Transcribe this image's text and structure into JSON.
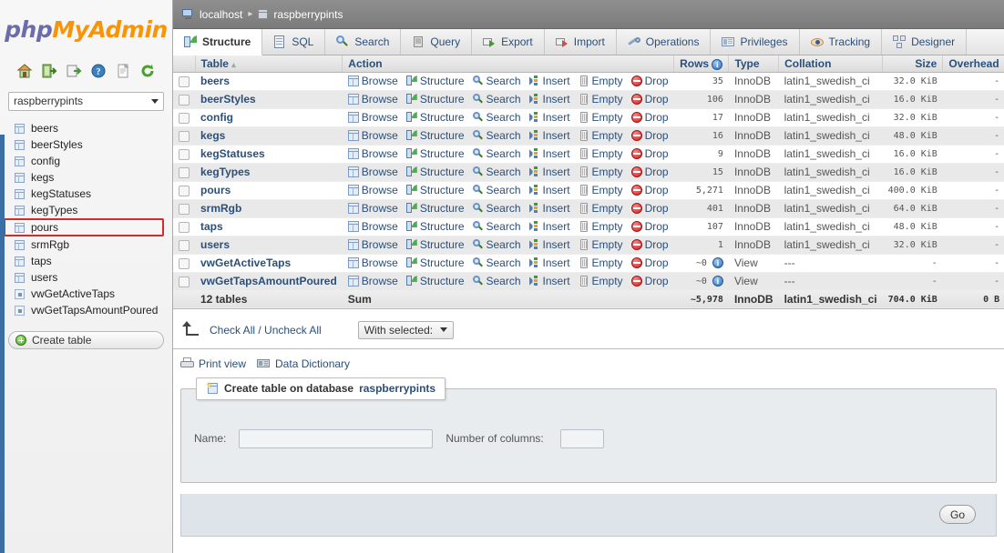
{
  "brand": {
    "php": "php",
    "my": "My",
    "admin": "Admin"
  },
  "sidebar": {
    "icons": [
      {
        "name": "home-icon",
        "title": "Home"
      },
      {
        "name": "logout-icon",
        "title": "Log out"
      },
      {
        "name": "query-window-icon",
        "title": "SQL query window"
      },
      {
        "name": "help-icon",
        "title": "phpMyAdmin documentation"
      },
      {
        "name": "docs-icon",
        "title": "Documentation"
      },
      {
        "name": "reload-icon",
        "title": "Reload navigation"
      }
    ],
    "db_select": {
      "value": "raspberrypints"
    },
    "tables": [
      {
        "label": "beers",
        "kind": "table",
        "highlighted": false
      },
      {
        "label": "beerStyles",
        "kind": "table",
        "highlighted": false
      },
      {
        "label": "config",
        "kind": "table",
        "highlighted": false
      },
      {
        "label": "kegs",
        "kind": "table",
        "highlighted": false
      },
      {
        "label": "kegStatuses",
        "kind": "table",
        "highlighted": false
      },
      {
        "label": "kegTypes",
        "kind": "table",
        "highlighted": false
      },
      {
        "label": "pours",
        "kind": "table",
        "highlighted": true
      },
      {
        "label": "srmRgb",
        "kind": "table",
        "highlighted": false
      },
      {
        "label": "taps",
        "kind": "table",
        "highlighted": false
      },
      {
        "label": "users",
        "kind": "table",
        "highlighted": false
      },
      {
        "label": "vwGetActiveTaps",
        "kind": "view",
        "highlighted": false
      },
      {
        "label": "vwGetTapsAmountPoured",
        "kind": "view",
        "highlighted": false
      }
    ],
    "create_table_label": "Create table"
  },
  "breadcrumb": {
    "server": "localhost",
    "separator": "▸",
    "database": "raspberrypints"
  },
  "tabs": [
    {
      "label": "Structure",
      "icon": "structure-icon",
      "active": true
    },
    {
      "label": "SQL",
      "icon": "sql-icon",
      "active": false
    },
    {
      "label": "Search",
      "icon": "search-icon",
      "active": false
    },
    {
      "label": "Query",
      "icon": "query-icon",
      "active": false
    },
    {
      "label": "Export",
      "icon": "export-icon",
      "active": false
    },
    {
      "label": "Import",
      "icon": "import-icon",
      "active": false
    },
    {
      "label": "Operations",
      "icon": "operations-icon",
      "active": false
    },
    {
      "label": "Privileges",
      "icon": "privileges-icon",
      "active": false
    },
    {
      "label": "Tracking",
      "icon": "tracking-icon",
      "active": false
    },
    {
      "label": "Designer",
      "icon": "designer-icon",
      "active": false
    }
  ],
  "structure": {
    "columns": {
      "check": "",
      "table": "Table",
      "sort_indicator": "▴",
      "action": "Action",
      "rows": "Rows",
      "rows_info": "i",
      "type": "Type",
      "collation": "Collation",
      "size": "Size",
      "overhead": "Overhead"
    },
    "action_labels": [
      "Browse",
      "Structure",
      "Search",
      "Insert",
      "Empty",
      "Drop"
    ],
    "rows": [
      {
        "name": "beers",
        "rows": "35",
        "type": "InnoDB",
        "collation": "latin1_swedish_ci",
        "size": "32.0 KiB",
        "overhead": "-",
        "is_view": false
      },
      {
        "name": "beerStyles",
        "rows": "106",
        "type": "InnoDB",
        "collation": "latin1_swedish_ci",
        "size": "16.0 KiB",
        "overhead": "-",
        "is_view": false
      },
      {
        "name": "config",
        "rows": "17",
        "type": "InnoDB",
        "collation": "latin1_swedish_ci",
        "size": "32.0 KiB",
        "overhead": "-",
        "is_view": false
      },
      {
        "name": "kegs",
        "rows": "16",
        "type": "InnoDB",
        "collation": "latin1_swedish_ci",
        "size": "48.0 KiB",
        "overhead": "-",
        "is_view": false
      },
      {
        "name": "kegStatuses",
        "rows": "9",
        "type": "InnoDB",
        "collation": "latin1_swedish_ci",
        "size": "16.0 KiB",
        "overhead": "-",
        "is_view": false
      },
      {
        "name": "kegTypes",
        "rows": "15",
        "type": "InnoDB",
        "collation": "latin1_swedish_ci",
        "size": "16.0 KiB",
        "overhead": "-",
        "is_view": false
      },
      {
        "name": "pours",
        "rows": "5,271",
        "type": "InnoDB",
        "collation": "latin1_swedish_ci",
        "size": "400.0 KiB",
        "overhead": "-",
        "is_view": false
      },
      {
        "name": "srmRgb",
        "rows": "401",
        "type": "InnoDB",
        "collation": "latin1_swedish_ci",
        "size": "64.0 KiB",
        "overhead": "-",
        "is_view": false
      },
      {
        "name": "taps",
        "rows": "107",
        "type": "InnoDB",
        "collation": "latin1_swedish_ci",
        "size": "48.0 KiB",
        "overhead": "-",
        "is_view": false
      },
      {
        "name": "users",
        "rows": "1",
        "type": "InnoDB",
        "collation": "latin1_swedish_ci",
        "size": "32.0 KiB",
        "overhead": "-",
        "is_view": false
      },
      {
        "name": "vwGetActiveTaps",
        "rows": "~0",
        "type": "View",
        "collation": "---",
        "size": "-",
        "overhead": "-",
        "is_view": true
      },
      {
        "name": "vwGetTapsAmountPoured",
        "rows": "~0",
        "type": "View",
        "collation": "---",
        "size": "-",
        "overhead": "-",
        "is_view": true
      }
    ],
    "summary": {
      "count_label": "12 tables",
      "sum_label": "Sum",
      "rows": "~5,978",
      "type": "InnoDB",
      "collation": "latin1_swedish_ci",
      "size": "704.0 KiB",
      "overhead": "0 B"
    }
  },
  "controls": {
    "check_all": "Check All / Uncheck All",
    "with_selected": "With selected:",
    "print_view": "Print view",
    "data_dictionary": "Data Dictionary"
  },
  "create_table": {
    "legend_prefix": "Create table on database",
    "legend_db": "raspberrypints",
    "name_label": "Name:",
    "name_value": "",
    "name_placeholder": "",
    "columns_label": "Number of columns:",
    "columns_value": "",
    "go_label": "Go"
  },
  "colors": {
    "brand_purple": "#6c6cab",
    "brand_orange": "#f89406",
    "link_blue": "#2a4f7a",
    "highlight_red": "#d42b2b",
    "page_bg": "#3a6ea5"
  }
}
